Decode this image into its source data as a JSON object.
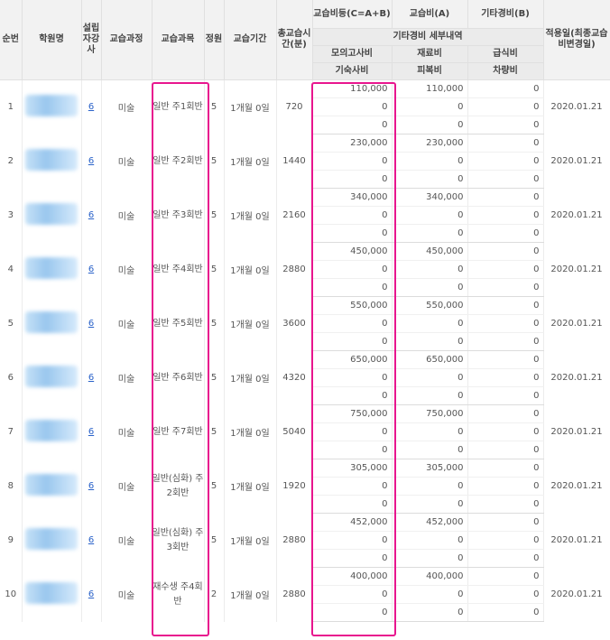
{
  "headers": {
    "no": "순번",
    "academy": "학원명",
    "founder": "설립자강사",
    "course": "교습과정",
    "subject": "교습과목",
    "capacity": "정원",
    "period": "교습기간",
    "total_hours": "총교습시간(분)",
    "fee_total": "교습비등(C=A+B)",
    "tuition": "교습비(A)",
    "other_cost": "기타경비(B)",
    "applied_date": "적용일(최종교습비변경일)",
    "other_detail": "기타경비 세부내역",
    "mock_exam": "모의고사비",
    "materials": "재료비",
    "meals": "급식비",
    "dormitory": "기숙사비",
    "clothing": "피복비",
    "vehicle": "차량비"
  },
  "rows": [
    {
      "no": "1",
      "founder": "6",
      "course": "미술",
      "subject": "일반 주1회반",
      "capacity": "5",
      "period": "1개월 0일",
      "hours": "720",
      "fee": [
        "110,000",
        "0",
        "0"
      ],
      "detail_a": [
        "110,000",
        "0",
        "0"
      ],
      "detail_b": [
        "0",
        "0",
        "0"
      ],
      "date": "2020.01.21"
    },
    {
      "no": "2",
      "founder": "6",
      "course": "미술",
      "subject": "일반 주2회반",
      "capacity": "5",
      "period": "1개월 0일",
      "hours": "1440",
      "fee": [
        "230,000",
        "0",
        "0"
      ],
      "detail_a": [
        "230,000",
        "0",
        "0"
      ],
      "detail_b": [
        "0",
        "0",
        "0"
      ],
      "date": "2020.01.21"
    },
    {
      "no": "3",
      "founder": "6",
      "course": "미술",
      "subject": "일반 주3회반",
      "capacity": "5",
      "period": "1개월 0일",
      "hours": "2160",
      "fee": [
        "340,000",
        "0",
        "0"
      ],
      "detail_a": [
        "340,000",
        "0",
        "0"
      ],
      "detail_b": [
        "0",
        "0",
        "0"
      ],
      "date": "2020.01.21"
    },
    {
      "no": "4",
      "founder": "6",
      "course": "미술",
      "subject": "일반 주4회반",
      "capacity": "5",
      "period": "1개월 0일",
      "hours": "2880",
      "fee": [
        "450,000",
        "0",
        "0"
      ],
      "detail_a": [
        "450,000",
        "0",
        "0"
      ],
      "detail_b": [
        "0",
        "0",
        "0"
      ],
      "date": "2020.01.21"
    },
    {
      "no": "5",
      "founder": "6",
      "course": "미술",
      "subject": "일반 주5회반",
      "capacity": "5",
      "period": "1개월 0일",
      "hours": "3600",
      "fee": [
        "550,000",
        "0",
        "0"
      ],
      "detail_a": [
        "550,000",
        "0",
        "0"
      ],
      "detail_b": [
        "0",
        "0",
        "0"
      ],
      "date": "2020.01.21"
    },
    {
      "no": "6",
      "founder": "6",
      "course": "미술",
      "subject": "일반 주6회반",
      "capacity": "5",
      "period": "1개월 0일",
      "hours": "4320",
      "fee": [
        "650,000",
        "0",
        "0"
      ],
      "detail_a": [
        "650,000",
        "0",
        "0"
      ],
      "detail_b": [
        "0",
        "0",
        "0"
      ],
      "date": "2020.01.21"
    },
    {
      "no": "7",
      "founder": "6",
      "course": "미술",
      "subject": "일반 주7회반",
      "capacity": "5",
      "period": "1개월 0일",
      "hours": "5040",
      "fee": [
        "750,000",
        "0",
        "0"
      ],
      "detail_a": [
        "750,000",
        "0",
        "0"
      ],
      "detail_b": [
        "0",
        "0",
        "0"
      ],
      "date": "2020.01.21"
    },
    {
      "no": "8",
      "founder": "6",
      "course": "미술",
      "subject": "일반(심화) 주2회반",
      "capacity": "5",
      "period": "1개월 0일",
      "hours": "1920",
      "fee": [
        "305,000",
        "0",
        "0"
      ],
      "detail_a": [
        "305,000",
        "0",
        "0"
      ],
      "detail_b": [
        "0",
        "0",
        "0"
      ],
      "date": "2020.01.21"
    },
    {
      "no": "9",
      "founder": "6",
      "course": "미술",
      "subject": "일반(심화) 주3회반",
      "capacity": "5",
      "period": "1개월 0일",
      "hours": "2880",
      "fee": [
        "452,000",
        "0",
        "0"
      ],
      "detail_a": [
        "452,000",
        "0",
        "0"
      ],
      "detail_b": [
        "0",
        "0",
        "0"
      ],
      "date": "2020.01.21"
    },
    {
      "no": "10",
      "founder": "6",
      "course": "미술",
      "subject": "재수생 주4회반",
      "capacity": "2",
      "period": "1개월 0일",
      "hours": "2880",
      "fee": [
        "400,000",
        "0",
        "0"
      ],
      "detail_a": [
        "400,000",
        "0",
        "0"
      ],
      "detail_b": [
        "0",
        "0",
        "0"
      ],
      "date": "2020.01.21"
    }
  ],
  "highlight_color": "#e8158e"
}
